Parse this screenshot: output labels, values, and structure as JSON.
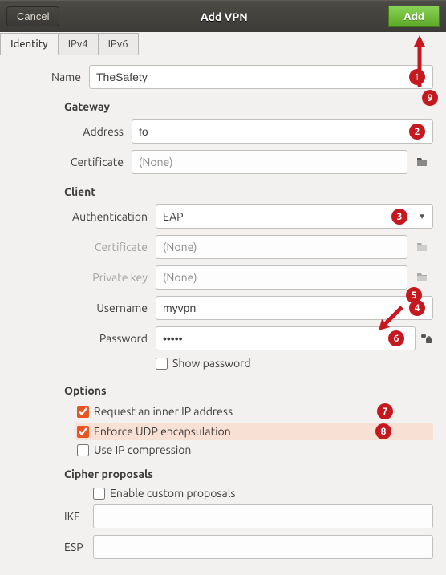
{
  "window": {
    "cancel": "Cancel",
    "title": "Add VPN",
    "add": "Add"
  },
  "tabs": {
    "identity": "Identity",
    "ipv4": "IPv4",
    "ipv6": "IPv6"
  },
  "identity": {
    "name_label": "Name",
    "name_value": "TheSafety",
    "gateway": {
      "title": "Gateway",
      "address_label": "Address",
      "address_value": "fo",
      "certificate_label": "Certificate",
      "certificate_value": "(None)"
    },
    "client": {
      "title": "Client",
      "auth_label": "Authentication",
      "auth_value": "EAP",
      "certificate_label": "Certificate",
      "certificate_value": "(None)",
      "privkey_label": "Private key",
      "privkey_value": "(None)",
      "username_label": "Username",
      "username_value": "myvpn",
      "password_label": "Password",
      "password_value": "•••••",
      "show_password_label": "Show password"
    },
    "options": {
      "title": "Options",
      "request_inner": "Request an inner IP address",
      "enforce_udp": "Enforce UDP encapsulation",
      "use_ip_compression": "Use IP compression"
    },
    "cipher": {
      "title": "Cipher proposals",
      "enable_custom": "Enable custom proposals",
      "ike_label": "IKE",
      "ike_value": "",
      "esp_label": "ESP",
      "esp_value": ""
    }
  },
  "annotations": {
    "b1": "1",
    "b2": "2",
    "b3": "3",
    "b4": "4",
    "b5": "5",
    "b6": "6",
    "b7": "7",
    "b8": "8",
    "b9": "9"
  }
}
